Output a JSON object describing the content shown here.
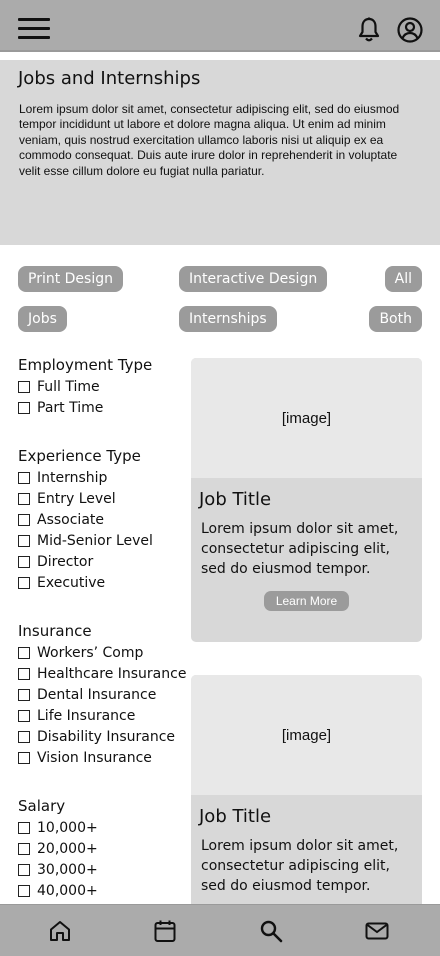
{
  "header": {
    "menu_icon": "hamburger-menu-icon",
    "notification_icon": "bell-icon",
    "profile_icon": "user-circle-icon"
  },
  "hero": {
    "title": "Jobs and Internships",
    "description": "Lorem ipsum dolor sit amet, consectetur adipiscing elit, sed do eiusmod tempor incididunt ut labore et dolore magna aliqua. Ut enim ad minim veniam, quis nostrud exercitation ullamco laboris nisi ut aliquip ex ea commodo consequat. Duis aute irure dolor in reprehenderit in voluptate velit esse cillum dolore eu fugiat nulla pariatur."
  },
  "chips": {
    "row1": [
      "Print Design",
      "Interactive Design",
      "All"
    ],
    "row2": [
      "Jobs",
      "Internships",
      "Both"
    ]
  },
  "filters": {
    "employment": {
      "title": "Employment Type",
      "options": [
        "Full Time",
        "Part Time"
      ]
    },
    "experience": {
      "title": "Experience Type",
      "options": [
        "Internship",
        "Entry Level",
        "Associate",
        "Mid-Senior Level",
        "Director",
        "Executive"
      ]
    },
    "insurance": {
      "title": "Insurance",
      "options": [
        "Workers’ Comp",
        "Healthcare Insurance",
        "Dental Insurance",
        "Life Insurance",
        "Disability Insurance",
        "Vision Insurance"
      ]
    },
    "salary": {
      "title": "Salary",
      "options": [
        "10,000+",
        "20,000+",
        "30,000+",
        "40,000+"
      ]
    }
  },
  "cards": [
    {
      "image": "[image]",
      "title": "Job Title",
      "text": "Lorem ipsum dolor sit amet, consectetur adipiscing elit, sed do eiusmod tempor.",
      "button": "Learn More"
    },
    {
      "image": "[image]",
      "title": "Job Title",
      "text": "Lorem ipsum dolor sit amet, consectetur adipiscing elit, sed do eiusmod tempor."
    }
  ],
  "bottom_nav": [
    "home-icon",
    "calendar-icon",
    "search-icon",
    "mail-icon"
  ],
  "colors": {
    "bar": "#ababab",
    "panel": "#d8d8d8",
    "chip": "#9b9b9b",
    "image_placeholder": "#e8e8e8"
  }
}
